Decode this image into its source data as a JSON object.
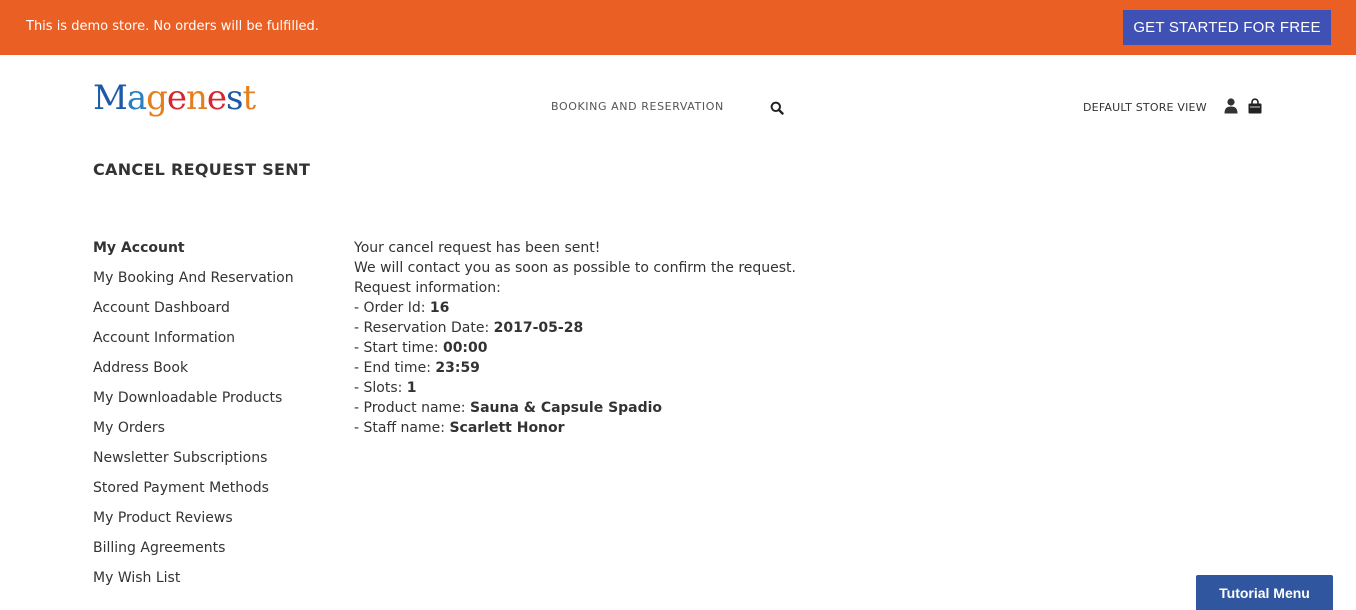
{
  "banner": {
    "notice": "This is demo store. No orders will be fulfilled.",
    "cta_label": "GET STARTED FOR FREE",
    "background_color": "#e95f24",
    "cta_color": "#3f51b5"
  },
  "header": {
    "logo_text": "Magenest",
    "nav_booking": "BOOKING AND RESERVATION",
    "store_view": "DEFAULT STORE VIEW",
    "icons": [
      "search-icon",
      "user-icon",
      "cart-icon"
    ]
  },
  "page": {
    "title": "CANCEL REQUEST SENT"
  },
  "sidebar": {
    "heading": "My Account",
    "items": [
      "My Booking And Reservation",
      "Account Dashboard",
      "Account Information",
      "Address Book",
      "My Downloadable Products",
      "My Orders",
      "Newsletter Subscriptions",
      "Stored Payment Methods",
      "My Product Reviews",
      "Billing Agreements",
      "My Wish List"
    ]
  },
  "content": {
    "line1": "Your cancel request has been sent!",
    "line2": "We will contact you as soon as possible to confirm the request.",
    "line3": "Request information:",
    "fields": [
      {
        "label": "- Order Id: ",
        "value": "16"
      },
      {
        "label": "- Reservation Date: ",
        "value": "2017-05-28"
      },
      {
        "label": "- Start time: ",
        "value": "00:00"
      },
      {
        "label": "- End time: ",
        "value": "23:59"
      },
      {
        "label": "- Slots: ",
        "value": "1"
      },
      {
        "label": "- Product name: ",
        "value": "Sauna & Capsule Spadio"
      },
      {
        "label": "- Staff name: ",
        "value": "Scarlett Honor"
      }
    ]
  },
  "footer": {
    "tutorial_menu": "Tutorial Menu"
  }
}
